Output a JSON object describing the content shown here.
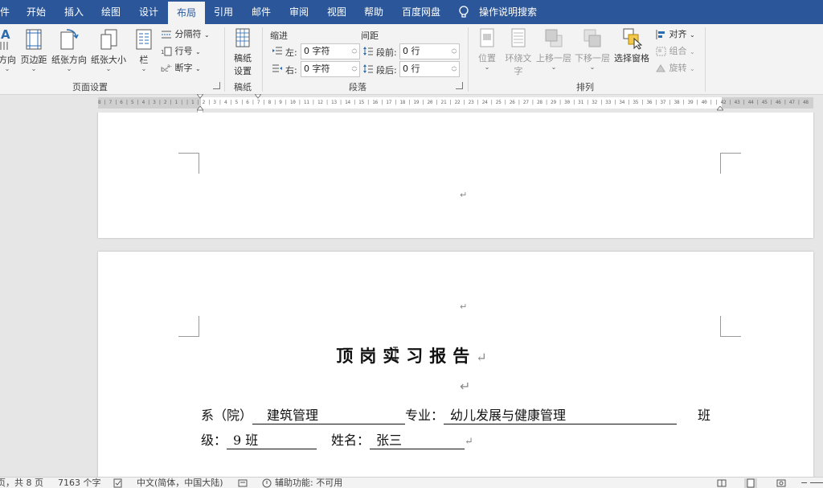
{
  "tabs": [
    {
      "label": "件",
      "active": false
    },
    {
      "label": "开始",
      "active": false
    },
    {
      "label": "插入",
      "active": false
    },
    {
      "label": "绘图",
      "active": false
    },
    {
      "label": "设计",
      "active": false
    },
    {
      "label": "布局",
      "active": true
    },
    {
      "label": "引用",
      "active": false
    },
    {
      "label": "邮件",
      "active": false
    },
    {
      "label": "审阅",
      "active": false
    },
    {
      "label": "视图",
      "active": false
    },
    {
      "label": "帮助",
      "active": false
    },
    {
      "label": "百度网盘",
      "active": false
    }
  ],
  "tell_me": "操作说明搜索",
  "ribbon": {
    "page_setup": {
      "group_label": "页面设置",
      "direction_label": "方向",
      "margins_label": "页边距",
      "orientation_label": "纸张方向",
      "size_label": "纸张大小",
      "columns_label": "栏",
      "breaks_label": "分隔符",
      "line_numbers_label": "行号",
      "hyphenation_label": "断字"
    },
    "manuscript": {
      "group_label": "稿纸",
      "button_line1": "稿纸",
      "button_line2": "设置"
    },
    "paragraph": {
      "group_label": "段落",
      "indent_header": "缩进",
      "spacing_header": "间距",
      "left_label": "左:",
      "left_value": "0 字符",
      "right_label": "右:",
      "right_value": "0 字符",
      "before_label": "段前:",
      "before_value": "0 行",
      "after_label": "段后:",
      "after_value": "0 行"
    },
    "arrange": {
      "group_label": "排列",
      "position_label": "位置",
      "wrap_line1": "环绕文",
      "wrap_line2": "字",
      "forward_label": "上移一层",
      "backward_label": "下移一层",
      "selection_pane_label": "选择窗格",
      "align_label": "对齐",
      "group_btn_label": "组合",
      "rotate_label": "旋转"
    }
  },
  "ruler": {
    "scale_text": "8 | 7 | 6 | 5 | 4 | 3 | 2 | 1 |    | 1 | 2 | 3 | 4 | 5 | 6 | 7 | 8 | 9 | 10 | 11 | 12 | 13 | 14 | 15 | 16 | 17 | 18 | 19 | 20 | 21 | 22 | 23 | 24 | 25 | 26 | 27 | 28 | 29 | 30 | 31 | 32 | 33 | 34 | 35 | 36 | 37 | 38 | 39 | 40 |    | 42 | 43 | 44 | 45 | 46 | 47 | 48"
  },
  "document": {
    "paragraph_mark": "↵",
    "title": "顶岗实习报告",
    "line1": {
      "dept_label": "系（院）",
      "dept_value": "建筑管理",
      "major_label": "专业：",
      "major_value": "幼儿发展与健康管理",
      "class_label_part1": "班"
    },
    "line2": {
      "class_label_part2": "级：",
      "class_value": "9 班",
      "name_label": "姓名：",
      "name_value": "张三"
    }
  },
  "statusbar": {
    "page_info": "页，共 8 页",
    "word_count": "7163 个字",
    "language": "中文(简体，中国大陆)",
    "accessibility": "辅助功能: 不可用"
  },
  "colors": {
    "tab_bar": "#2b579a",
    "ribbon_bg": "#f3f3f3",
    "canvas_bg": "#e6e6e6"
  }
}
